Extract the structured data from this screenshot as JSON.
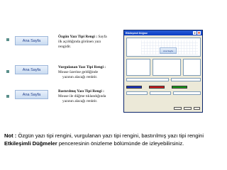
{
  "items": [
    {
      "button_label": "Ana Sayfa",
      "title": "Özgün Yazı Tipi Rengi :",
      "lines": [
        "Sayfa",
        "ilk açıldığında görünen yazı",
        "rengidir."
      ]
    },
    {
      "button_label": "Ana Sayfa",
      "title": "Vurgulanan Yazı Tipi Rengi :",
      "lines": [
        "Mouse üzerine geldiğinde",
        "yazının alacağı renktir."
      ]
    },
    {
      "button_label": "Ana Sayfa",
      "title": "Bastırılmış Yazı Tipi Rengi :",
      "lines": [
        "Mouse ile düğme tıklandığında",
        "yazının alacağı renktir."
      ]
    }
  ],
  "dialog": {
    "title": "Etkileşimli Düğme",
    "preview_button_label": "Ana Sayfa",
    "close_glyph": "✕",
    "help_glyph": "?"
  },
  "colors": {
    "bullet": "#5a8f8a",
    "button_text": "#1e3c8a",
    "dialog_titlebar": "#0a3cc4",
    "swatch_blue": "#1c36c8",
    "swatch_red": "#d41c1c",
    "swatch_green": "#1a9c1a"
  },
  "note": {
    "prefix": "Not :",
    "text1": " Özgün yazı tipi rengini, vurgulanan yazı tipi rengini, bastırılmış yazı tipi rengini ",
    "bold": "Etkileşimli Düğmeler",
    "text2": " penceresinin önizleme bölümünde de izleyebilirsiniz."
  }
}
